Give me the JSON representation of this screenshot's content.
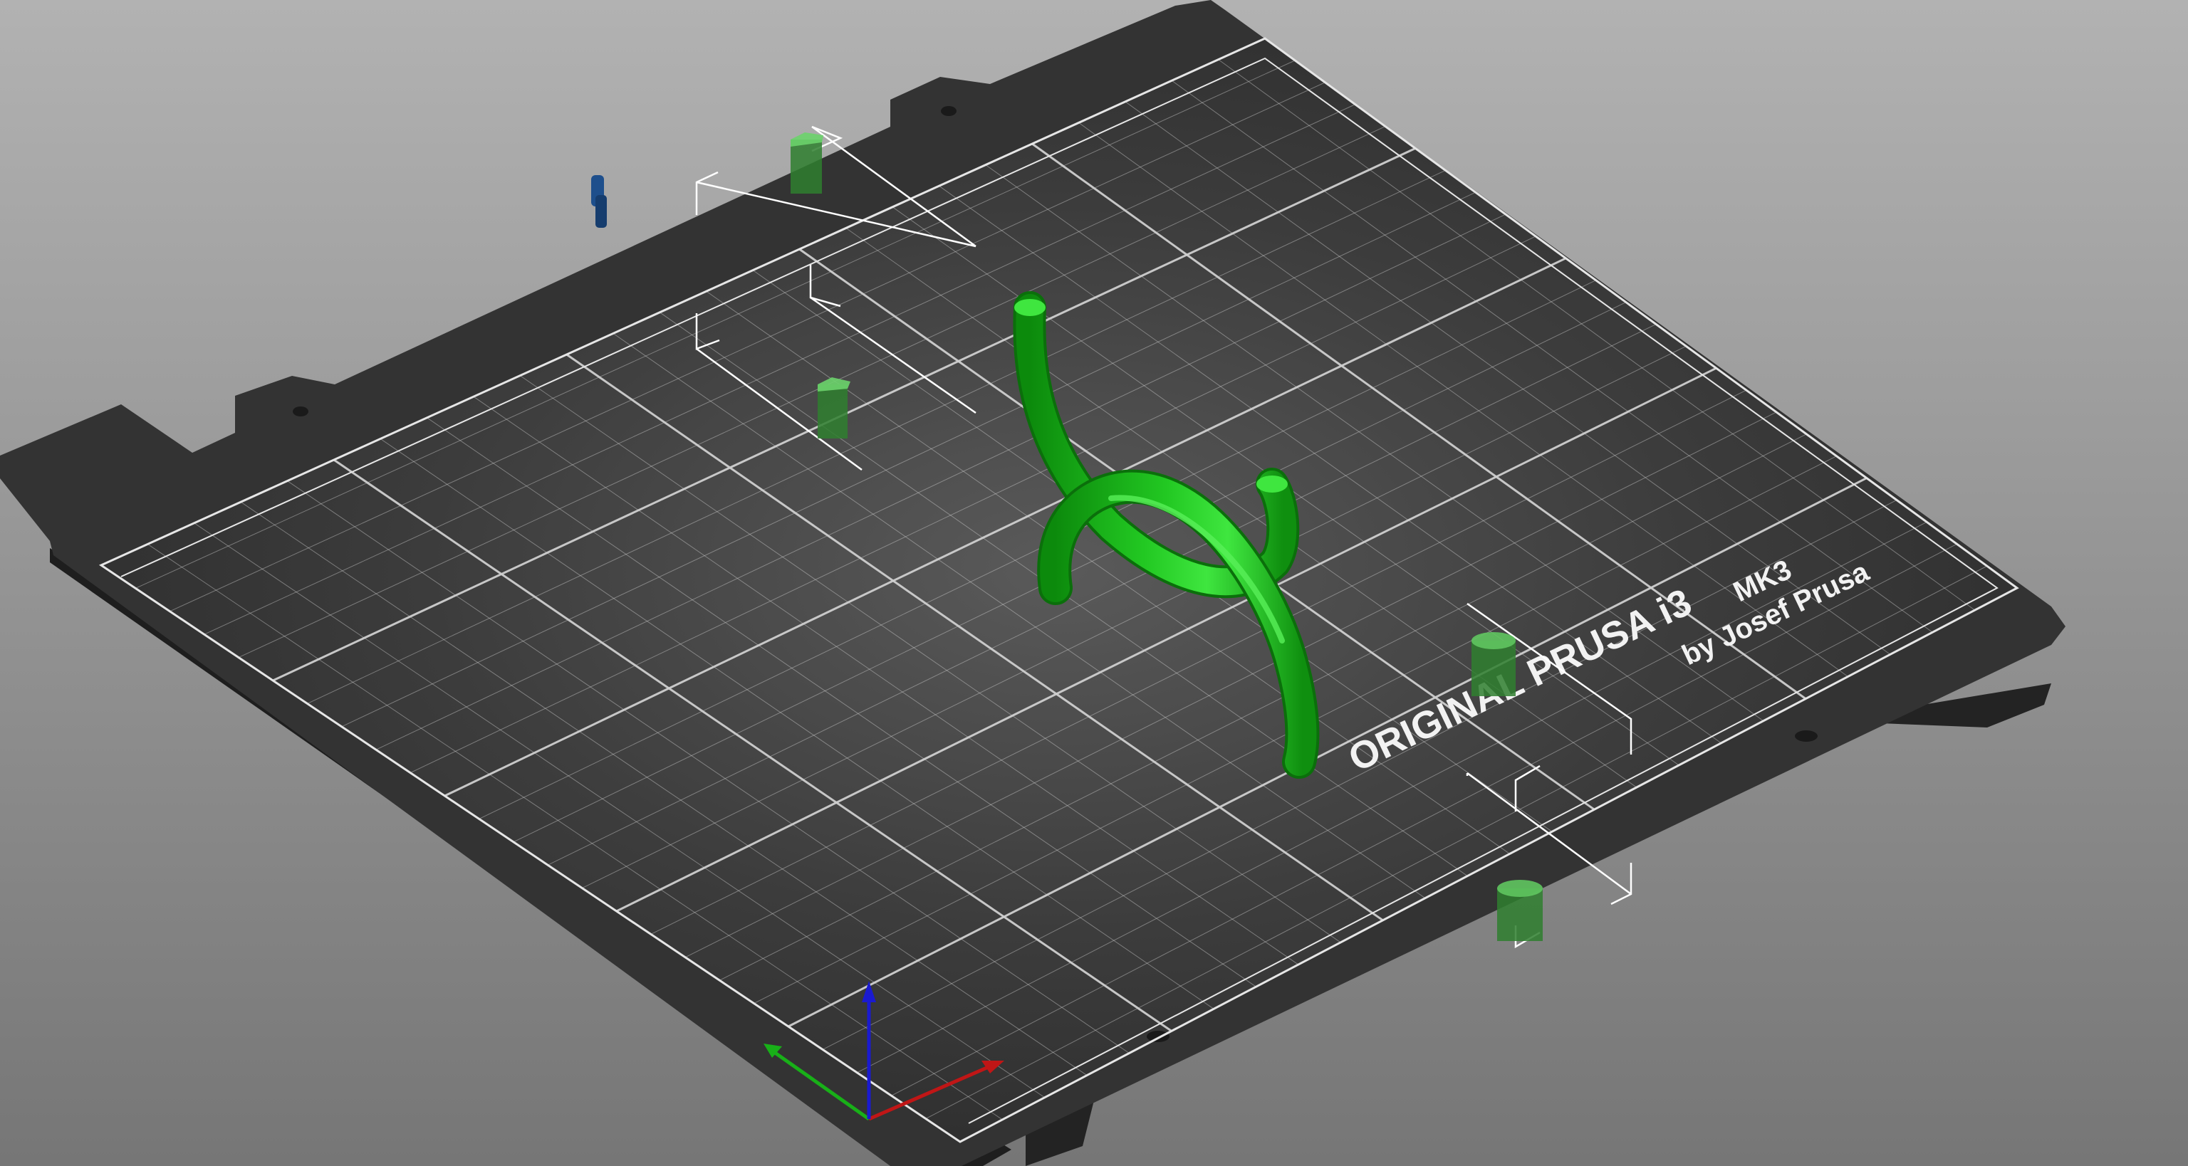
{
  "viewport": {
    "background_top": "#b0b0b0",
    "background_bottom": "#7a7a7a"
  },
  "bed": {
    "brand_line": "ORIGINAL PRUSA i3",
    "model_suffix": "MK3",
    "byline": "by Josef Prusa",
    "surface_color": "#3a3a3a",
    "frame_color": "#2b2b2b",
    "edge_color": "#1c1c1c",
    "grid_color": "#cfcfcf"
  },
  "model": {
    "color": "#18b318",
    "highlight": "#3fe63f",
    "shadow": "#0c800c"
  },
  "axes": {
    "x_color": "#c01616",
    "y_color": "#18b018",
    "z_color": "#1a1ad0"
  },
  "gizmo": {
    "box_color": "#ffffff",
    "handle_color": "#3fa83f",
    "handle_color_blue": "#1e4f8c"
  }
}
